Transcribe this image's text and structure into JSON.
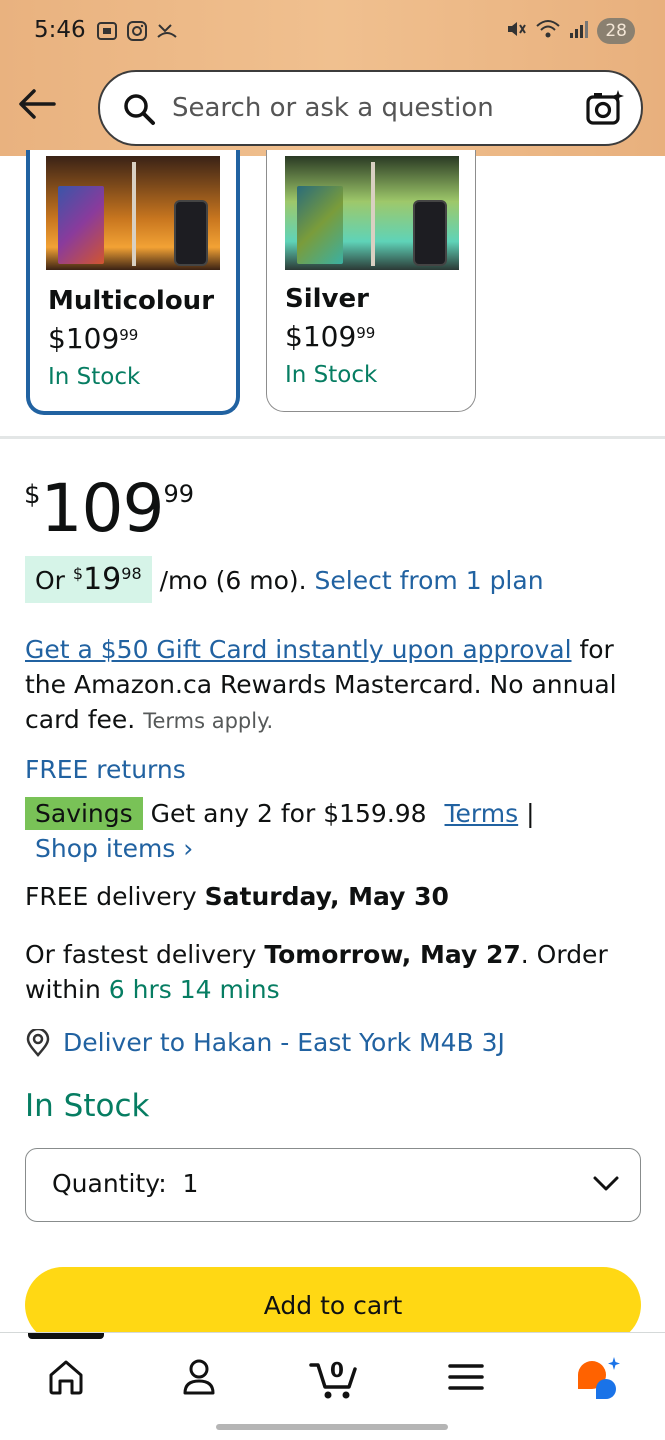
{
  "status": {
    "time": "5:46",
    "battery": "28"
  },
  "search": {
    "placeholder": "Search or ask a question"
  },
  "variants": [
    {
      "name": "Multicolour",
      "price_whole": "$109",
      "price_cents": "99",
      "stock": "In Stock",
      "selected": true
    },
    {
      "name": "Silver",
      "price_whole": "$109",
      "price_cents": "99",
      "stock": "In Stock",
      "selected": false
    }
  ],
  "price": {
    "currency": "$",
    "whole": "109",
    "cents": "99"
  },
  "plan": {
    "or": "Or ",
    "currency": "$",
    "whole": "19",
    "cents": "98",
    "suffix": " /mo (6 mo). ",
    "link": "Select from 1 plan"
  },
  "gift": {
    "link": "Get a $50 Gift Card instantly upon approval",
    "text": " for the Amazon.ca Rewards Mastercard. No annual card fee. ",
    "small": "Terms apply."
  },
  "returns": "FREE returns",
  "savings": {
    "tag": "Savings",
    "text": " Get any 2 for $159.98 ",
    "terms": "Terms",
    "sep": " |",
    "shop": "Shop items ›"
  },
  "delivery": {
    "prefix": "FREE delivery ",
    "date": "Saturday, May 30"
  },
  "fastest": {
    "prefix": "Or fastest delivery ",
    "date": "Tomorrow, May 27",
    "mid": ". Order within ",
    "countdown": "6 hrs 14 mins"
  },
  "deliver_to": "Deliver to Hakan - East York M4B 3J",
  "in_stock": "In Stock",
  "quantity": {
    "label": "Quantity:",
    "value": "1"
  },
  "add_to_cart": "Add to cart",
  "colors": {
    "header": "#efbd8b",
    "link": "#2162a1",
    "green": "#067d62",
    "cart": "#ffd814",
    "savings": "#79c257"
  },
  "nav": {
    "icons": [
      "home-icon",
      "account-icon",
      "cart-icon",
      "menu-icon",
      "rufus-icon"
    ],
    "cart_count": "0"
  }
}
